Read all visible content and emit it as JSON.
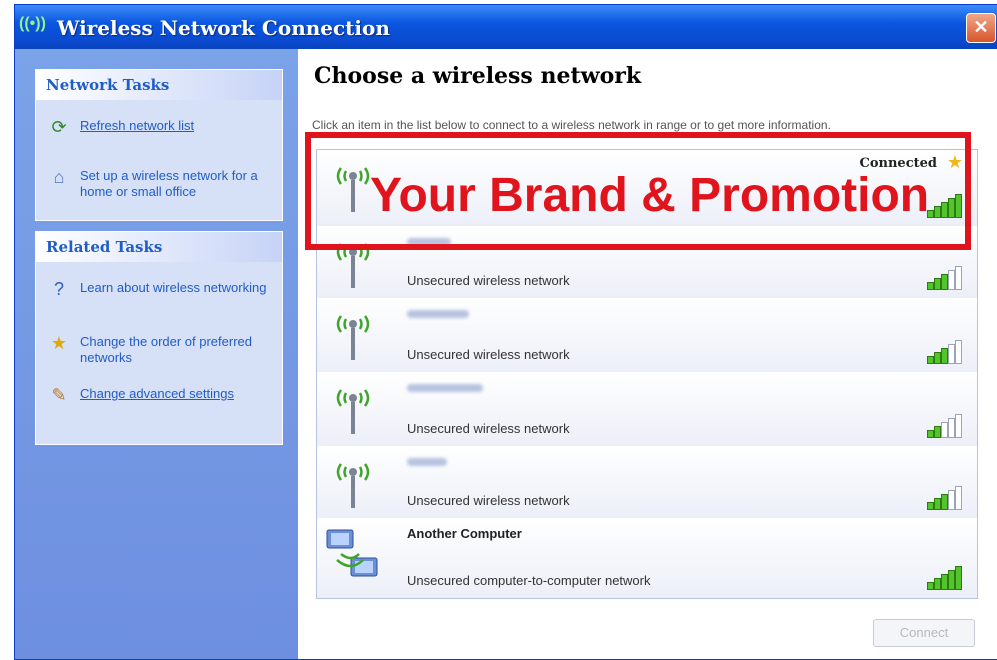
{
  "window": {
    "title": "Wireless Network Connection",
    "title_icon": "((•))"
  },
  "sidebar": {
    "network_tasks": {
      "header": "Network Tasks",
      "items": [
        {
          "label": "Refresh network list",
          "icon": "refresh-icon",
          "glyph": "⟳"
        },
        {
          "label": "Set up a wireless network for a home or small office",
          "icon": "setup-network-icon",
          "glyph": "⌂"
        }
      ]
    },
    "related_tasks": {
      "header": "Related Tasks",
      "items": [
        {
          "label": "Learn about wireless networking",
          "icon": "help-icon",
          "glyph": "?"
        },
        {
          "label": "Change the order of preferred networks",
          "icon": "star-icon",
          "glyph": "★"
        },
        {
          "label": "Change advanced settings",
          "icon": "settings-icon",
          "glyph": "✎"
        }
      ]
    }
  },
  "main": {
    "heading": "Choose a wireless network",
    "description": "Click an item in the list below to connect to a wireless network in range or to get more information.",
    "networks": [
      {
        "name": "",
        "status": "Connected",
        "security": "",
        "signal": 5
      },
      {
        "name": "",
        "status": "",
        "security": "Unsecured wireless network",
        "signal": 3
      },
      {
        "name": "",
        "status": "",
        "security": "Unsecured wireless network",
        "signal": 3
      },
      {
        "name": "",
        "status": "",
        "security": "Unsecured wireless network",
        "signal": 2
      },
      {
        "name": "",
        "status": "",
        "security": "Unsecured wireless network",
        "signal": 3
      },
      {
        "name": "Another Computer",
        "status": "",
        "security": "Unsecured computer-to-computer network",
        "signal": 5
      }
    ],
    "connect_label": "Connect"
  },
  "promo": {
    "text": "Your Brand & Promotion"
  },
  "colors": {
    "accent": "#0b56e0",
    "promo": "#e0141c",
    "signal_on": "#52c42c"
  }
}
